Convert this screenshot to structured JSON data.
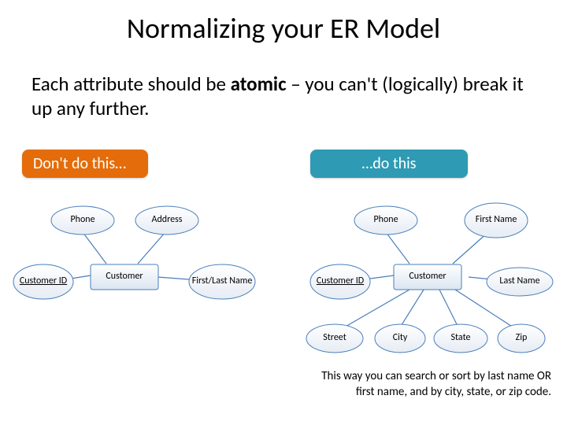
{
  "title": "Normalizing your ER Model",
  "subtitle_pre": "Each attribute should be ",
  "subtitle_bold": "atomic",
  "subtitle_post": " – you can't (logically) break it up any further.",
  "pills": {
    "dont": "Don't do this…",
    "do": "…do this"
  },
  "left": {
    "phone": "Phone",
    "address": "Address",
    "customer_id": "Customer ID",
    "customer": "Customer",
    "first_last_name": "First/Last Name"
  },
  "right": {
    "phone": "Phone",
    "first_name": "First Name",
    "customer_id": "Customer ID",
    "customer": "Customer",
    "last_name": "Last Name",
    "street": "Street",
    "city": "City",
    "state": "State",
    "zip": "Zip"
  },
  "caption_line1": "This way you can search or sort by last name OR",
  "caption_line2": "first name, and by city, state, or zip code."
}
